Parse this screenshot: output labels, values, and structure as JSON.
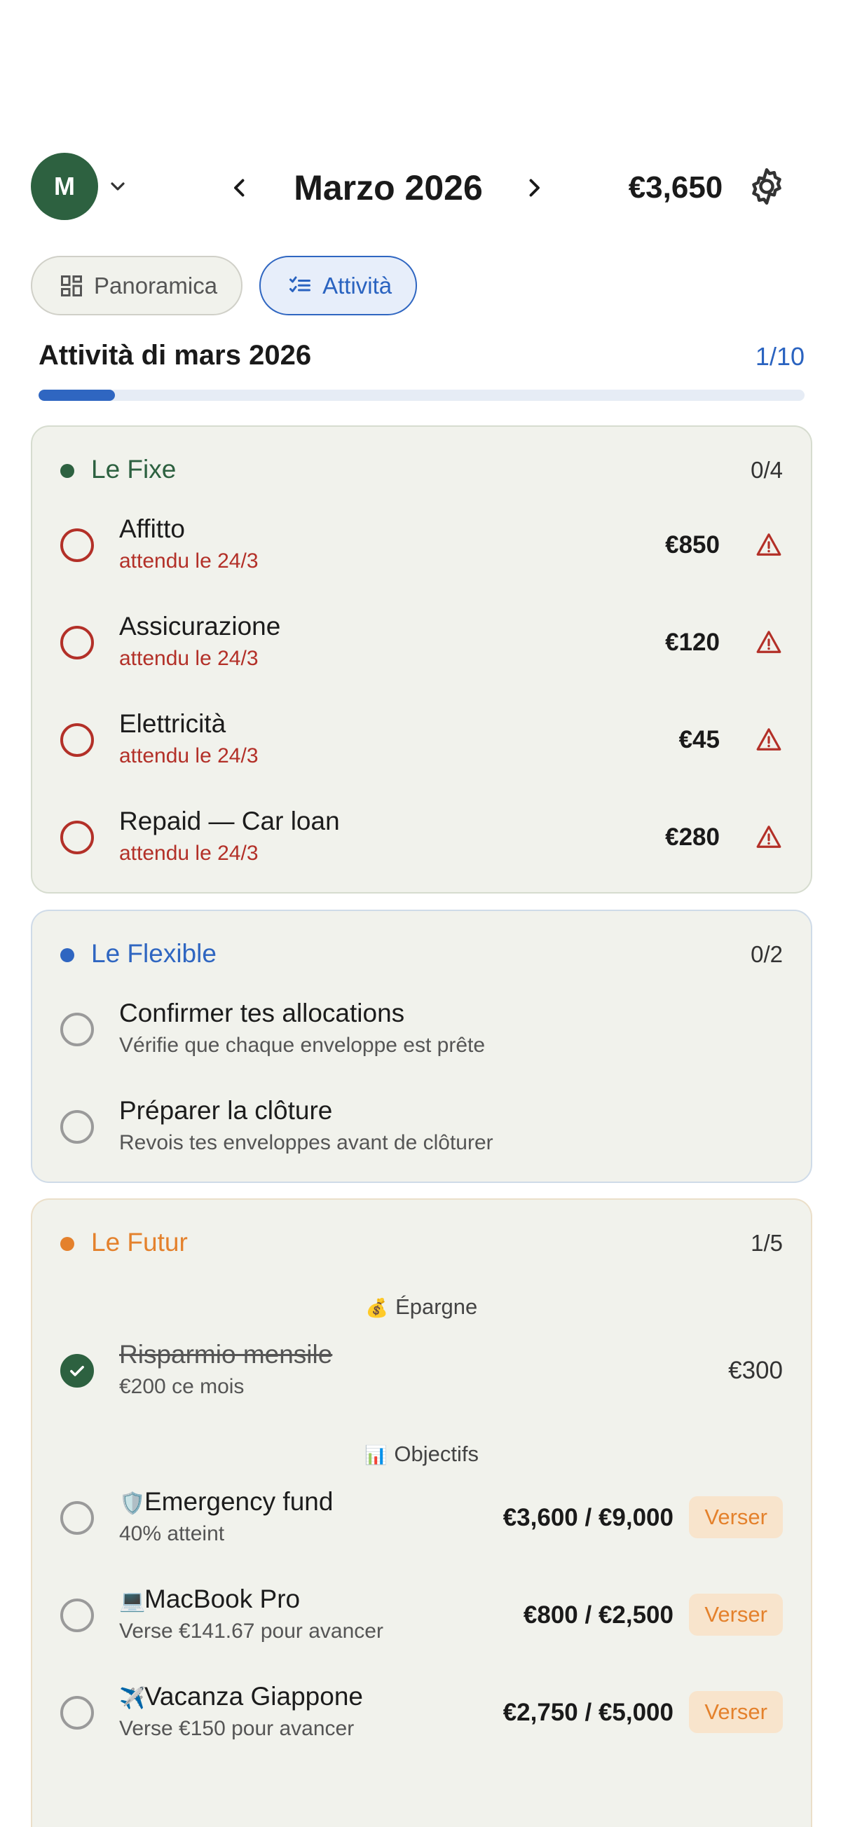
{
  "header": {
    "avatar_initial": "M",
    "month_title": "Marzo 2026",
    "balance": "€3,650"
  },
  "tabs": [
    {
      "label": "Panoramica",
      "icon": "grid-icon",
      "active": false
    },
    {
      "label": "Attività",
      "icon": "checklist-icon",
      "active": true
    }
  ],
  "activity": {
    "title": "Attività di mars 2026",
    "progress_label": "1/10",
    "progress_done": 1,
    "progress_total": 10
  },
  "colors": {
    "fixe": "#2d6140",
    "flexible": "#2f66c1",
    "futur": "#e4812c",
    "overdue": "#b33028"
  },
  "fixe": {
    "name": "Le Fixe",
    "count": "0/4",
    "items": [
      {
        "title": "Affitto",
        "sub": "attendu le 24/3",
        "amount": "€850"
      },
      {
        "title": "Assicurazione",
        "sub": "attendu le 24/3",
        "amount": "€120"
      },
      {
        "title": "Elettricità",
        "sub": "attendu le 24/3",
        "amount": "€45"
      },
      {
        "title": "Repaid — Car loan",
        "sub": "attendu le 24/3",
        "amount": "€280"
      }
    ]
  },
  "flexible": {
    "name": "Le Flexible",
    "count": "0/2",
    "items": [
      {
        "title": "Confirmer tes allocations",
        "sub": "Vérifie que chaque enveloppe est prête"
      },
      {
        "title": "Préparer la clôture",
        "sub": "Revois tes enveloppes avant de clôturer"
      }
    ]
  },
  "futur": {
    "name": "Le Futur",
    "count": "1/5",
    "savings_heading": "Épargne",
    "savings_icon": "💰",
    "savings_item": {
      "title": "Risparmio mensile",
      "sub": "€200 ce mois",
      "amount": "€300",
      "done": true
    },
    "goals_heading": "Objectifs",
    "goals_icon": "📊",
    "goals": [
      {
        "emoji": "🛡️",
        "title": "Emergency fund",
        "sub": "40% atteint",
        "amount": "€3,600 / €9,000",
        "action": "Verser"
      },
      {
        "emoji": "💻",
        "title": "MacBook Pro",
        "sub": "Verse €141.67 pour avancer",
        "amount": "€800 / €2,500",
        "action": "Verser"
      },
      {
        "emoji": "✈️",
        "title": "Vacanza Giappone",
        "sub": "Verse €150 pour avancer",
        "amount": "€2,750 / €5,000",
        "action": "Verser"
      }
    ]
  }
}
